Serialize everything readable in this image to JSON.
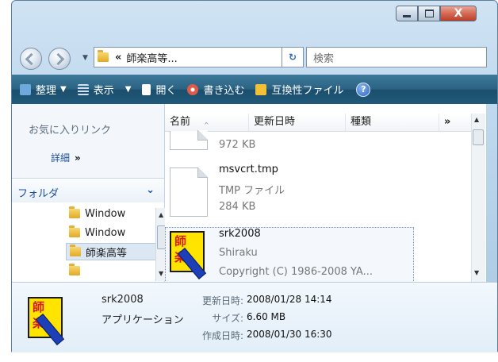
{
  "window": {
    "caption_buttons": [
      "minimize",
      "maximize",
      "close"
    ],
    "close_glyph": "X"
  },
  "address_bar": {
    "chevron": "«",
    "path": "師楽高等...",
    "search_placeholder": "検索"
  },
  "toolbar": {
    "items": [
      {
        "label": "整理",
        "icon": "organize-icon",
        "color": "#6fa8dc"
      },
      {
        "label": "表示",
        "icon": "views-icon",
        "color": "#cfe0f0"
      },
      {
        "label": "開く",
        "icon": "open-icon",
        "color": "#ffffff"
      },
      {
        "label": "書き込む",
        "icon": "burn-icon",
        "color": "#e05a4a"
      },
      {
        "label": "互換性ファイル",
        "icon": "compat-files-icon",
        "color": "#f2c037"
      }
    ],
    "help": "?"
  },
  "nav_pane": {
    "favorites_title": "お気に入りリンク",
    "details_link": "詳細",
    "details_chevron": "»",
    "folders_label": "フォルダ",
    "tree": [
      "Window",
      "Window",
      "師楽高等",
      ""
    ]
  },
  "columns": [
    "名前",
    "更新日時",
    "種類",
    "»"
  ],
  "files": [
    {
      "size": "972 KB"
    },
    {
      "name": "msvcrt.tmp",
      "type": "TMP ファイル",
      "size": "284 KB"
    },
    {
      "name": "srk2008",
      "company": "Shiraku",
      "copyright": "Copyright (C) 1986-2008 YA..."
    }
  ],
  "details": {
    "name": "srk2008",
    "type": "アプリケーション",
    "modified_label": "更新日時:",
    "modified": "2008/01/28 14:14",
    "size_label": "サイズ:",
    "size": "6.60 MB",
    "created_label": "作成日時:",
    "created": "2008/01/30 16:30"
  },
  "app_icon": {
    "char1": "師",
    "char2": "楽"
  }
}
